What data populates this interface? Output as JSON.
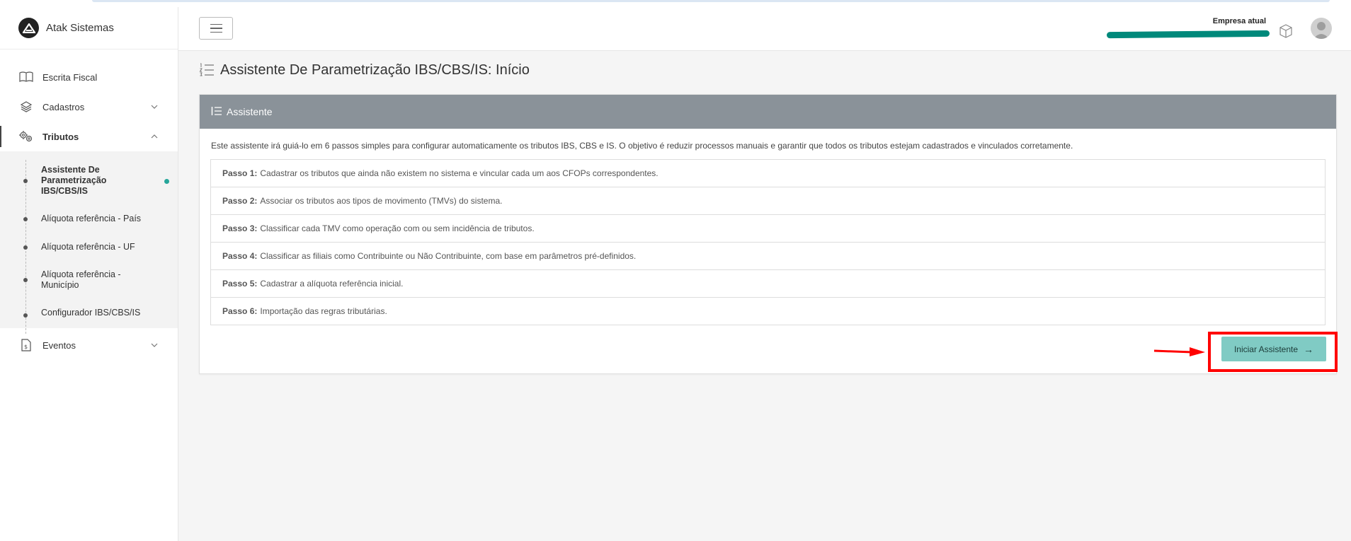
{
  "brand": {
    "name": "Atak Sistemas"
  },
  "sidebar": {
    "items": [
      {
        "label": "Escrita Fiscal",
        "icon": "book-icon"
      },
      {
        "label": "Cadastros",
        "icon": "layers-icon"
      },
      {
        "label": "Tributos",
        "icon": "gears-icon"
      },
      {
        "label": "Eventos",
        "icon": "document-dollar-icon"
      }
    ],
    "submenu": [
      {
        "label": "Assistente De Parametrização IBS/CBS/IS"
      },
      {
        "label": "Alíquota referência - País"
      },
      {
        "label": "Alíquota referência - UF"
      },
      {
        "label": "Alíquota referência - Município"
      },
      {
        "label": "Configurador IBS/CBS/IS"
      }
    ]
  },
  "header": {
    "company_label": "Empresa atual"
  },
  "page": {
    "title": "Assistente De Parametrização IBS/CBS/IS: Início"
  },
  "card": {
    "header": "Assistente",
    "description": "Este assistente irá guiá-lo em 6 passos simples para configurar automaticamente os tributos IBS, CBS e IS. O objetivo é reduzir processos manuais e garantir que todos os tributos estejam cadastrados e vinculados corretamente.",
    "steps": [
      {
        "label": "Passo 1:",
        "text": "Cadastrar os tributos que ainda não existem no sistema e vincular cada um aos CFOPs correspondentes."
      },
      {
        "label": "Passo 2:",
        "text": "Associar os tributos aos tipos de movimento (TMVs) do sistema."
      },
      {
        "label": "Passo 3:",
        "text": "Classificar cada TMV como operação com ou sem incidência de tributos."
      },
      {
        "label": "Passo 4:",
        "text": "Classificar as filiais como Contribuinte ou Não Contribuinte, com base em parâmetros pré-definidos."
      },
      {
        "label": "Passo 5:",
        "text": "Cadastrar a alíquota referência inicial."
      },
      {
        "label": "Passo 6:",
        "text": "Importação das regras tributárias."
      }
    ],
    "start_button": "Iniciar Assistente",
    "start_button_arrow": "→"
  },
  "colors": {
    "accent": "#26a69a",
    "button": "#80cbc4",
    "card_header": "#8a9299",
    "company_bar": "#00897b",
    "highlight": "#ff0000"
  }
}
